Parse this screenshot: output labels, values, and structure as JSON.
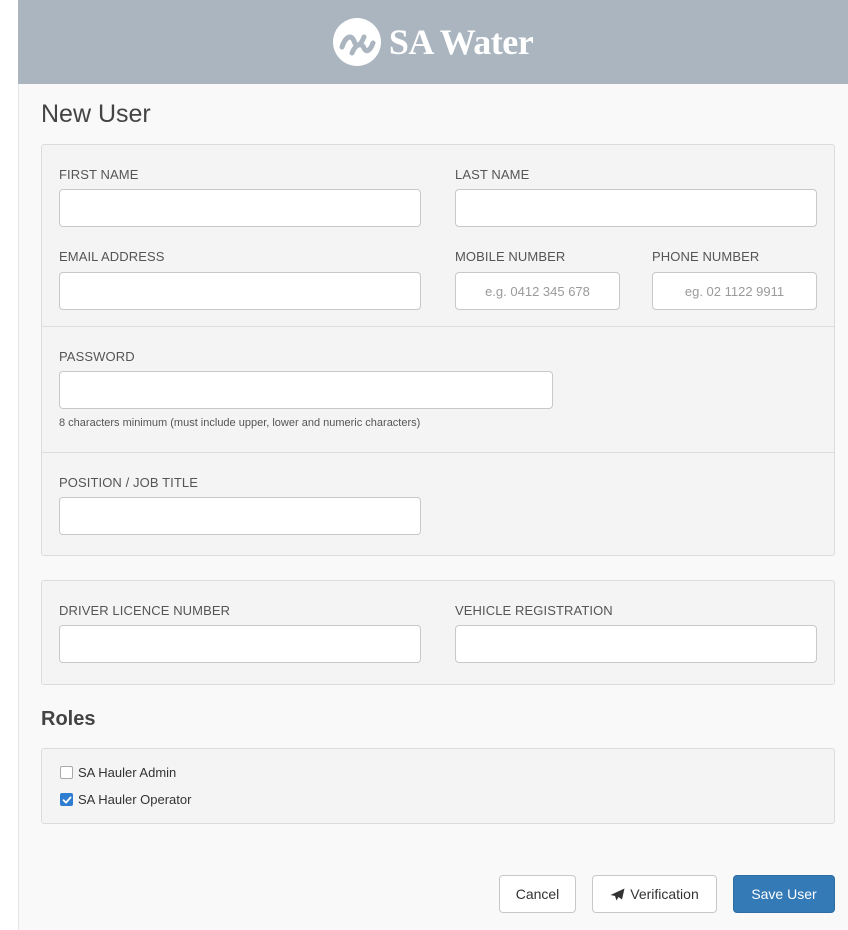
{
  "header": {
    "brand": "SA Water",
    "logo_icon": "sa-water-logo-icon"
  },
  "page": {
    "title": "New User",
    "roles_title": "Roles"
  },
  "user_panel": {
    "first_name": {
      "label": "FIRST NAME",
      "value": "",
      "placeholder": ""
    },
    "last_name": {
      "label": "LAST NAME",
      "value": "",
      "placeholder": ""
    },
    "email": {
      "label": "EMAIL ADDRESS",
      "value": "",
      "placeholder": ""
    },
    "mobile": {
      "label": "MOBILE NUMBER",
      "value": "",
      "placeholder": "e.g. 0412 345 678"
    },
    "phone": {
      "label": "PHONE NUMBER",
      "value": "",
      "placeholder": "eg. 02 1122 9911"
    },
    "password": {
      "label": "PASSWORD",
      "value": "",
      "help": "8 characters minimum (must include upper, lower and numeric characters)"
    },
    "position": {
      "label": "POSITION / JOB TITLE",
      "value": ""
    }
  },
  "vehicle_panel": {
    "licence": {
      "label": "DRIVER LICENCE NUMBER",
      "value": ""
    },
    "registration": {
      "label": "VEHICLE REGISTRATION",
      "value": ""
    }
  },
  "roles": [
    {
      "label": "SA Hauler Admin",
      "checked": false
    },
    {
      "label": "SA Hauler Operator",
      "checked": true
    }
  ],
  "actions": {
    "cancel": "Cancel",
    "verification": "Verification",
    "verification_icon": "paper-plane-icon",
    "save": "Save User"
  },
  "colors": {
    "header_bg": "#aab5c0",
    "primary": "#337ab7",
    "checkbox_checked": "#2f7dd1"
  }
}
